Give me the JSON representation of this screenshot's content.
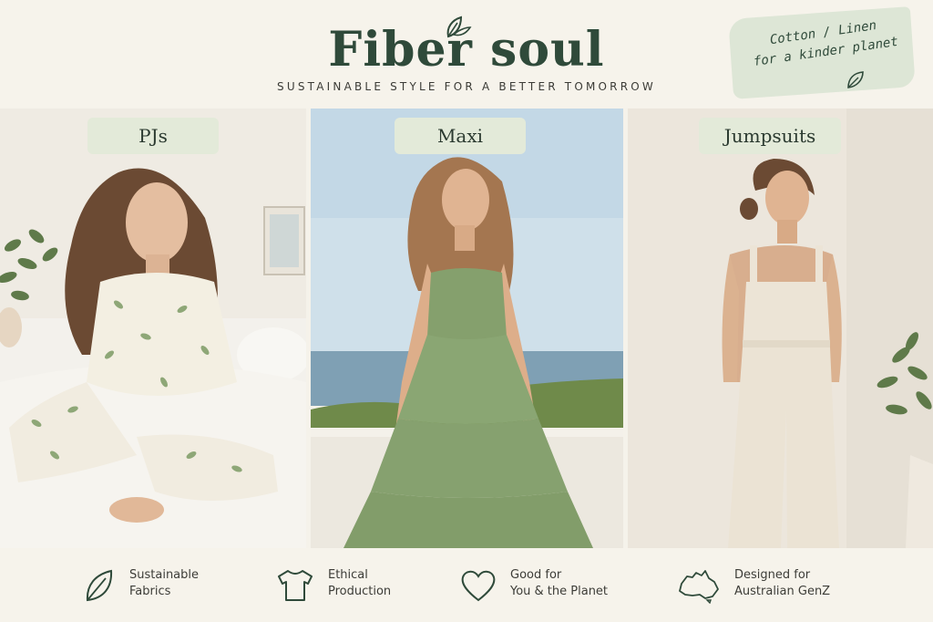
{
  "brand": {
    "name": "Fiber soul",
    "tagline": "SUSTAINABLE STYLE FOR A BETTER TOMORROW",
    "badge_line1": "Cotton / Linen",
    "badge_line2": "for a kinder planet"
  },
  "categories": [
    {
      "label": "PJs"
    },
    {
      "label": "Maxi"
    },
    {
      "label": "Jumpsuits"
    }
  ],
  "features": [
    {
      "icon": "leaf-icon",
      "line1": "Sustainable",
      "line2": "Fabrics"
    },
    {
      "icon": "tshirt-icon",
      "line1": "Ethical",
      "line2": "Production"
    },
    {
      "icon": "heart-icon",
      "line1": "Good for",
      "line2": "You & the Planet"
    },
    {
      "icon": "australia-map-icon",
      "line1": "Designed for",
      "line2": "Australian GenZ"
    }
  ],
  "colors": {
    "brand_green": "#2f4a3a",
    "sage": "#8ea777",
    "cream": "#f5f2ea"
  }
}
